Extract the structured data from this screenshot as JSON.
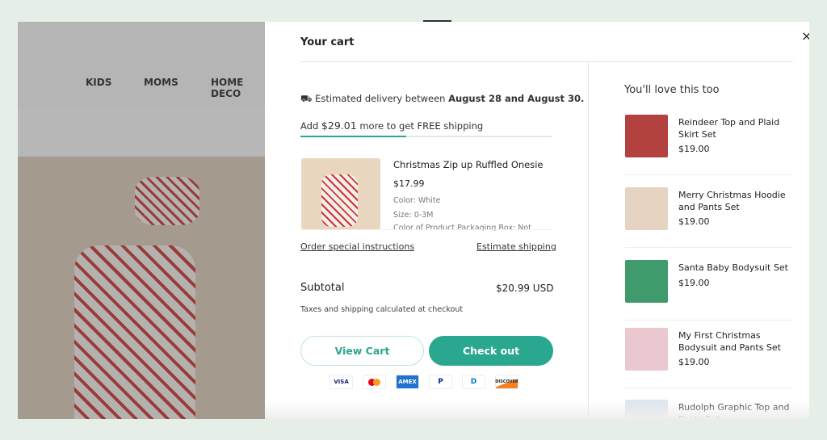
{
  "store_nav": {
    "items": [
      "KIDS",
      "MOMS",
      "HOME DECO"
    ]
  },
  "cart": {
    "title": "Your cart",
    "delivery_prefix": "Estimated delivery between ",
    "delivery_dates": "August 28 and August 30.",
    "shipping_prefix": "Add ",
    "shipping_amount": "$29.01",
    "shipping_suffix": " more to get FREE shipping",
    "free_shipping_progress": 0.42,
    "item": {
      "name": "Christmas Zip up Ruffled Onesie",
      "price": "$17.99",
      "color": "Color:  White",
      "size": "Size:  0-3M",
      "packaging": "Color of Product Packaging Box: Not"
    },
    "order_instructions": "Order special instructions",
    "estimate_shipping": "Estimate shipping",
    "subtotal_label": "Subtotal",
    "subtotal_value": "$20.99 USD",
    "tax_note": "Taxes and shipping calculated at checkout",
    "view_cart": "View Cart",
    "checkout": "Check out",
    "payments": [
      "VISA",
      "MC",
      "AMEX",
      "P",
      "D",
      "DISCOVER"
    ],
    "accent": "#2aa78f"
  },
  "recommendations": {
    "title": "You'll love this too",
    "items": [
      {
        "name": "Reindeer Top and Plaid Skirt Set",
        "price": "$19.00"
      },
      {
        "name": "Merry Christmas Hoodie and Pants Set",
        "price": "$19.00"
      },
      {
        "name": "Santa Baby Bodysuit Set",
        "price": "$19.00"
      },
      {
        "name": "My First Christmas Bodysuit and Pants Set",
        "price": "$19.00"
      },
      {
        "name": "Rudolph Graphic Top and Pants Set",
        "price": ""
      }
    ]
  }
}
